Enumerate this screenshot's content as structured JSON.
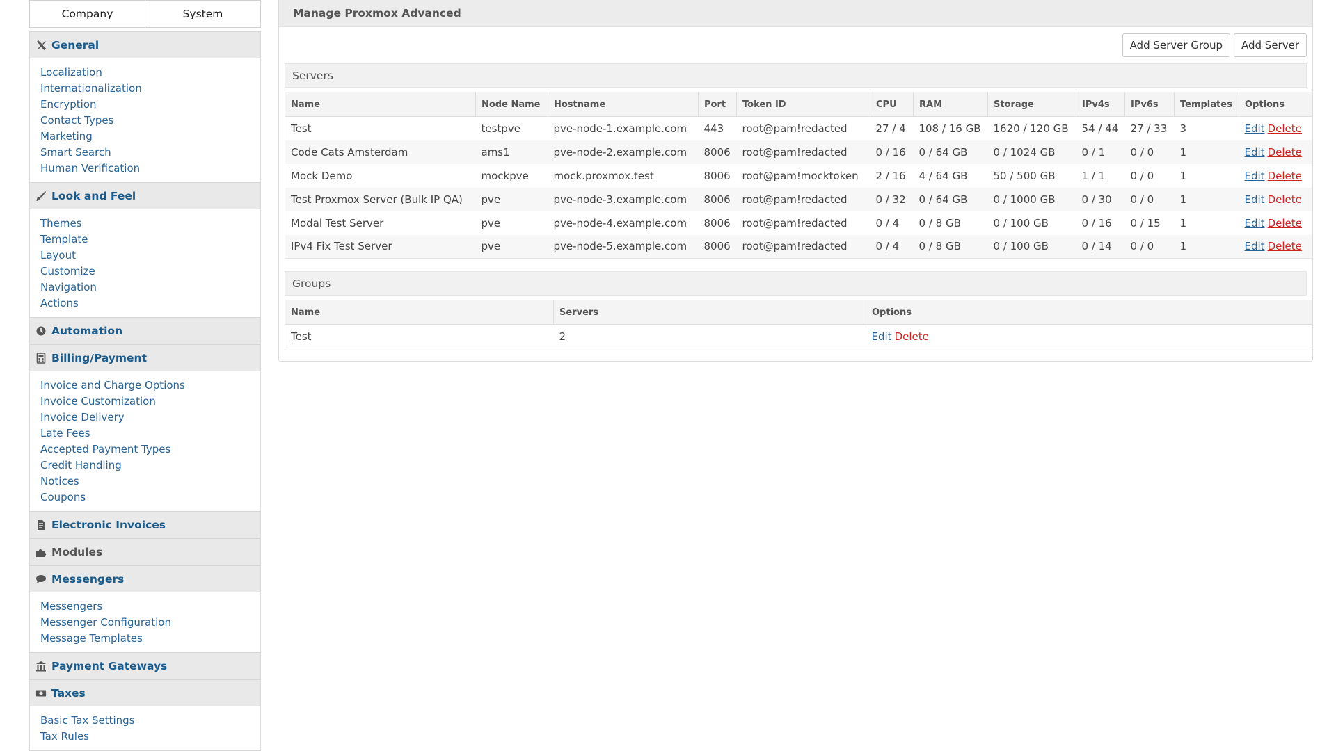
{
  "sidebar": {
    "tabs": [
      {
        "label": "Company"
      },
      {
        "label": "System"
      }
    ],
    "sections": {
      "general": {
        "label": "General",
        "icon": "tools-icon",
        "items": [
          "Localization",
          "Internationalization",
          "Encryption",
          "Contact Types",
          "Marketing",
          "Smart Search",
          "Human Verification"
        ]
      },
      "look": {
        "label": "Look and Feel",
        "icon": "brush-icon",
        "items": [
          "Themes",
          "Template",
          "Layout",
          "Customize",
          "Navigation",
          "Actions"
        ]
      },
      "automation": {
        "label": "Automation",
        "icon": "clock-icon"
      },
      "billing": {
        "label": "Billing/Payment",
        "icon": "calculator-icon",
        "items": [
          "Invoice and Charge Options",
          "Invoice Customization",
          "Invoice Delivery",
          "Late Fees",
          "Accepted Payment Types",
          "Credit Handling",
          "Notices",
          "Coupons"
        ]
      },
      "einvoices": {
        "label": "Electronic Invoices",
        "icon": "document-icon"
      },
      "modules": {
        "label": "Modules",
        "icon": "puzzle-icon"
      },
      "messengers": {
        "label": "Messengers",
        "icon": "chat-icon",
        "items": [
          "Messengers",
          "Messenger Configuration",
          "Message Templates"
        ]
      },
      "gateways": {
        "label": "Payment Gateways",
        "icon": "bank-icon"
      },
      "taxes": {
        "label": "Taxes",
        "icon": "money-icon",
        "items": [
          "Basic Tax Settings",
          "Tax Rules"
        ]
      }
    }
  },
  "main": {
    "title": "Manage Proxmox Advanced",
    "buttons": {
      "add_group": "Add Server Group",
      "add_server": "Add Server"
    },
    "servers": {
      "heading": "Servers",
      "columns": [
        "Name",
        "Node Name",
        "Hostname",
        "Port",
        "Token ID",
        "CPU",
        "RAM",
        "Storage",
        "IPv4s",
        "IPv6s",
        "Templates",
        "Options"
      ],
      "rows": [
        [
          "Test",
          "testpve",
          "pve-node-1.example.com",
          "443",
          "root@pam!redacted",
          "27 / 4",
          "108 / 16 GB",
          "1620 / 120 GB",
          "54 / 44",
          "27 / 33",
          "3"
        ],
        [
          "Code Cats Amsterdam",
          "ams1",
          "pve-node-2.example.com",
          "8006",
          "root@pam!redacted",
          "0 / 16",
          "0 / 64 GB",
          "0 / 1024 GB",
          "0 / 1",
          "0 / 0",
          "1"
        ],
        [
          "Mock Demo",
          "mockpve",
          "mock.proxmox.test",
          "8006",
          "root@pam!mocktoken",
          "2 / 16",
          "4 / 64 GB",
          "50 / 500 GB",
          "1 / 1",
          "0 / 0",
          "1"
        ],
        [
          "Test Proxmox Server (Bulk IP QA)",
          "pve",
          "pve-node-3.example.com",
          "8006",
          "root@pam!redacted",
          "0 / 32",
          "0 / 64 GB",
          "0 / 1000 GB",
          "0 / 30",
          "0 / 0",
          "1"
        ],
        [
          "Modal Test Server",
          "pve",
          "pve-node-4.example.com",
          "8006",
          "root@pam!redacted",
          "0 / 4",
          "0 / 8 GB",
          "0 / 100 GB",
          "0 / 16",
          "0 / 15",
          "1"
        ],
        [
          "IPv4 Fix Test Server",
          "pve",
          "pve-node-5.example.com",
          "8006",
          "root@pam!redacted",
          "0 / 4",
          "0 / 8 GB",
          "0 / 100 GB",
          "0 / 14",
          "0 / 0",
          "1"
        ]
      ]
    },
    "groups": {
      "heading": "Groups",
      "columns": [
        "Name",
        "Servers",
        "Options"
      ],
      "rows": [
        [
          "Test",
          "2"
        ]
      ]
    },
    "options": {
      "edit": "Edit",
      "delete": "Delete"
    }
  },
  "colors": {
    "link": "#2a6496",
    "delete": "#cc2222",
    "header_bg": "#e9e9e9"
  }
}
